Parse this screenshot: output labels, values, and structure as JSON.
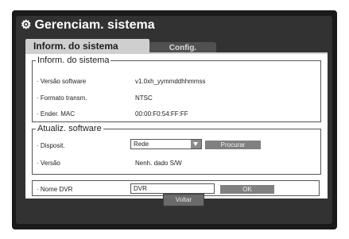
{
  "window": {
    "title": "Gerenciam. sistema"
  },
  "tabs": [
    {
      "label": "Inform. do sistema",
      "active": true
    },
    {
      "label": "Config.",
      "active": false
    }
  ],
  "system_info": {
    "legend": "Inform. do sistema",
    "rows": [
      {
        "label": "· Versão software",
        "value": "v1.0xh_yymmddhhmmss"
      },
      {
        "label": "· Formato transm.",
        "value": "NTSC"
      },
      {
        "label": "· Ender. MAC",
        "value": "00:00:F0:54:FF:FF"
      }
    ]
  },
  "software_update": {
    "legend": "Atualiz. software",
    "device_label": "· Disposit.",
    "device_value": "Rede",
    "search_button": "Procurar",
    "version_label": "· Versão",
    "version_value": "Nenh. dado S/W"
  },
  "dvr_name": {
    "label": "· Nome DVR",
    "value": "DVR",
    "ok_button": "OK"
  },
  "footer": {
    "back_button": "Voltar"
  },
  "colors": {
    "frame": "#1a1a1a",
    "window": "#323232",
    "tab_active": "#cfcfcf",
    "button": "#808080"
  }
}
